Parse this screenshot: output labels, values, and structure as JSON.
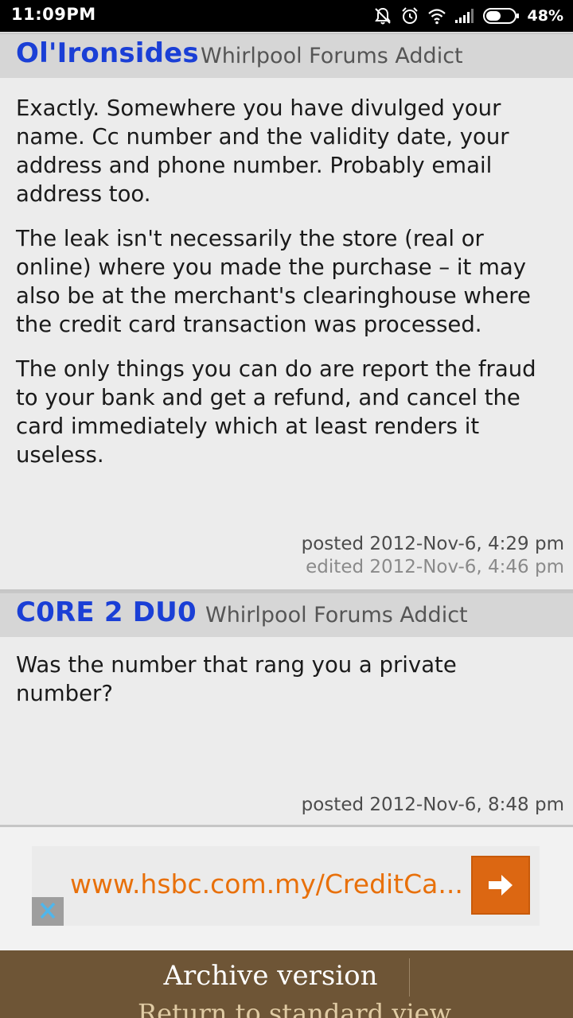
{
  "status_bar": {
    "time": "11:09PM",
    "battery_percent": "48%",
    "icons": [
      "notifications-off-icon",
      "alarm-icon",
      "wifi-icon",
      "signal-icon",
      "battery-icon"
    ]
  },
  "posts": [
    {
      "author": "Ol'Ironsides",
      "rank": "Whirlpool Forums Addict",
      "paragraphs": [
        "Exactly. Somewhere you have divulged your name. Cc number and the validity date, your address and phone number. Probably email address too.",
        "The leak isn't necessarily the store (real or online) where you made the purchase – it may also be at the merchant's clearinghouse where the credit card transaction was processed.",
        "The only things you can do are report the fraud to your bank and get a refund, and cancel the card immediately which at least renders it useless."
      ],
      "posted": "posted 2012-Nov-6, 4:29 pm",
      "edited": "edited 2012-Nov-6, 4:46 pm"
    },
    {
      "author": "C0RE 2 DU0",
      "rank": "Whirlpool Forums Addict",
      "paragraphs": [
        "Was the number that rang you a private number?"
      ],
      "posted": "posted 2012-Nov-6, 8:48 pm"
    }
  ],
  "ad": {
    "url_text": "www.hsbc.com.my/CreditCa...",
    "accent_color": "#dc6712",
    "arrow_icon": "arrow-right-icon",
    "close_icon": "close-icon"
  },
  "footer": {
    "title": "Archive version",
    "link": "Return to standard view"
  }
}
